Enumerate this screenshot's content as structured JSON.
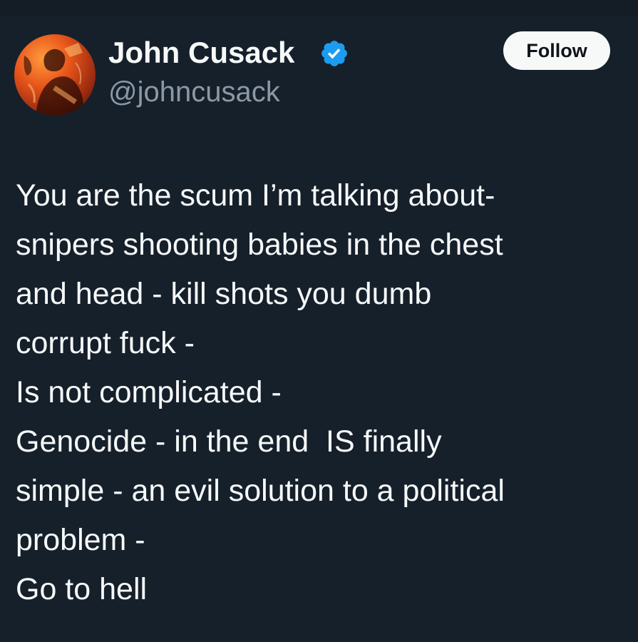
{
  "colors": {
    "background": "#15202b",
    "text_primary": "#f7f9f9",
    "text_secondary": "#8b98a5",
    "verified_blue": "#1d9bf0",
    "follow_button_bg": "#f7f9f9",
    "follow_button_text": "#0f1419"
  },
  "author": {
    "name": "John Cusack",
    "handle": "@johncusack",
    "verified": true,
    "avatar_icon": "profile-avatar",
    "verified_icon": "verified-badge-icon"
  },
  "actions": {
    "follow_label": "Follow"
  },
  "tweet": {
    "lines": [
      "You are the scum I’m talking about-",
      "snipers shooting babies in the chest",
      "and head - kill shots you dumb",
      "corrupt fuck -",
      "Is not complicated -",
      "Genocide - in the end  IS finally",
      "simple - an evil solution to a political",
      "problem -",
      "Go to hell"
    ]
  }
}
